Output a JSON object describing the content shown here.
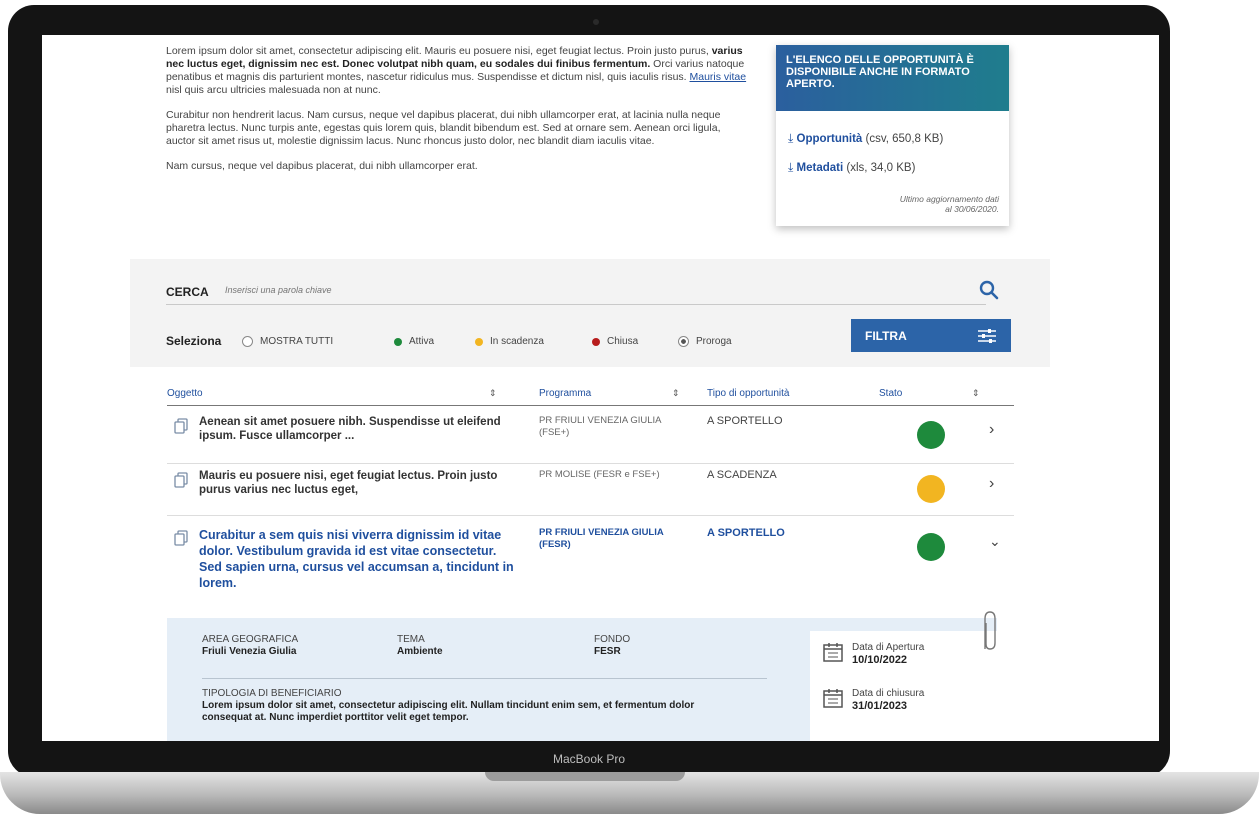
{
  "intro": {
    "p1_a": "Lorem ipsum dolor sit amet, consectetur adipiscing elit. Mauris eu posuere nisi, eget feugiat lectus. Proin justo purus, ",
    "p1_b": "varius nec luctus eget, dignissim nec est. Donec volutpat nibh quam, eu sodales dui finibus fermentum.",
    "p1_c": " Orci varius natoque penatibus et magnis dis parturient montes, nascetur ridiculus mus. Suspendisse et dictum nisl, quis iaculis risus. ",
    "p1_link": "Mauris vitae",
    "p1_d": " nisl quis arcu ultricies malesuada non at nunc.",
    "p2": "Curabitur non hendrerit lacus. Nam cursus, neque vel dapibus placerat, dui nibh ullamcorper erat, at lacinia nulla neque pharetra lectus. Nunc turpis ante, egestas quis lorem quis, blandit bibendum est. Sed at ornare sem. Aenean orci ligula, auctor sit amet risus ut, molestie dignissim lacus. Nunc rhoncus justo dolor, nec blandit diam iaculis vitae.",
    "p3": "Nam cursus, neque vel dapibus placerat, dui nibh ullamcorper erat."
  },
  "open_data": {
    "header": "L'ELENCO DELLE OPPORTUNITÀ È DISPONIBILE ANCHE IN FORMATO APERTO.",
    "link1_label": "Opportunità",
    "link1_meta": "(csv, 650,8 KB)",
    "link2_label": "Metadati",
    "link2_meta": "(xls, 34,0 KB)",
    "updated_line1": "Ultimo aggiornamento dati",
    "updated_line2": "al 30/06/2020."
  },
  "search": {
    "label": "CERCA",
    "placeholder": "Inserisci una parola chiave"
  },
  "filters": {
    "label": "Seleziona",
    "show_all": "MOSTRA TUTTI",
    "active": "Attiva",
    "expiring": "In scadenza",
    "closed": "Chiusa",
    "extension": "Proroga",
    "button": "FILTRA"
  },
  "colors": {
    "green": "#1e8a3c",
    "yellow": "#f2b521",
    "red": "#b71c1c",
    "accent": "#2c64a8"
  },
  "table": {
    "headers": [
      "Oggetto",
      "Programma",
      "Tipo di opportunità",
      "Stato"
    ],
    "rows": [
      {
        "title": "Aenean sit amet posuere nibh. Suspendisse ut eleifend ipsum. Fusce ullamcorper ...",
        "programma": "PR FRIULI VENEZIA GIULIA (FSE+)",
        "tipo": "A SPORTELLO",
        "stato": "green"
      },
      {
        "title": "Mauris eu posuere nisi, eget feugiat lectus. Proin justo purus varius nec luctus eget,",
        "programma": "PR MOLISE (FESR e FSE+)",
        "tipo": "A SCADENZA",
        "stato": "yellow"
      },
      {
        "title": "Curabitur a sem quis nisi viverra dignissim id vitae dolor. Vestibulum gravida id est vitae consectetur. Sed sapien urna, cursus vel accumsan a, tincidunt in lorem.",
        "programma": "PR FRIULI VENEZIA GIULIA (FESR)",
        "tipo": "A SPORTELLO",
        "stato": "green"
      }
    ]
  },
  "detail": {
    "area_label": "AREA GEOGRAFICA",
    "area_value": "Friuli Venezia Giulia",
    "tema_label": "TEMA",
    "tema_value": "Ambiente",
    "fondo_label": "FONDO",
    "fondo_value": "FESR",
    "benef_label": "TIPOLOGIA DI BENEFICIARIO",
    "benef_value": "Lorem ipsum dolor sit amet, consectetur adipiscing elit. Nullam tincidunt enim sem, et fermentum dolor consequat at. Nunc imperdiet porttitor velit eget tempor.",
    "open_label": "Data di Apertura",
    "open_value": "10/10/2022",
    "close_label": "Data di chiusura",
    "close_value": "31/01/2023"
  },
  "device": {
    "brand": "MacBook Pro"
  }
}
